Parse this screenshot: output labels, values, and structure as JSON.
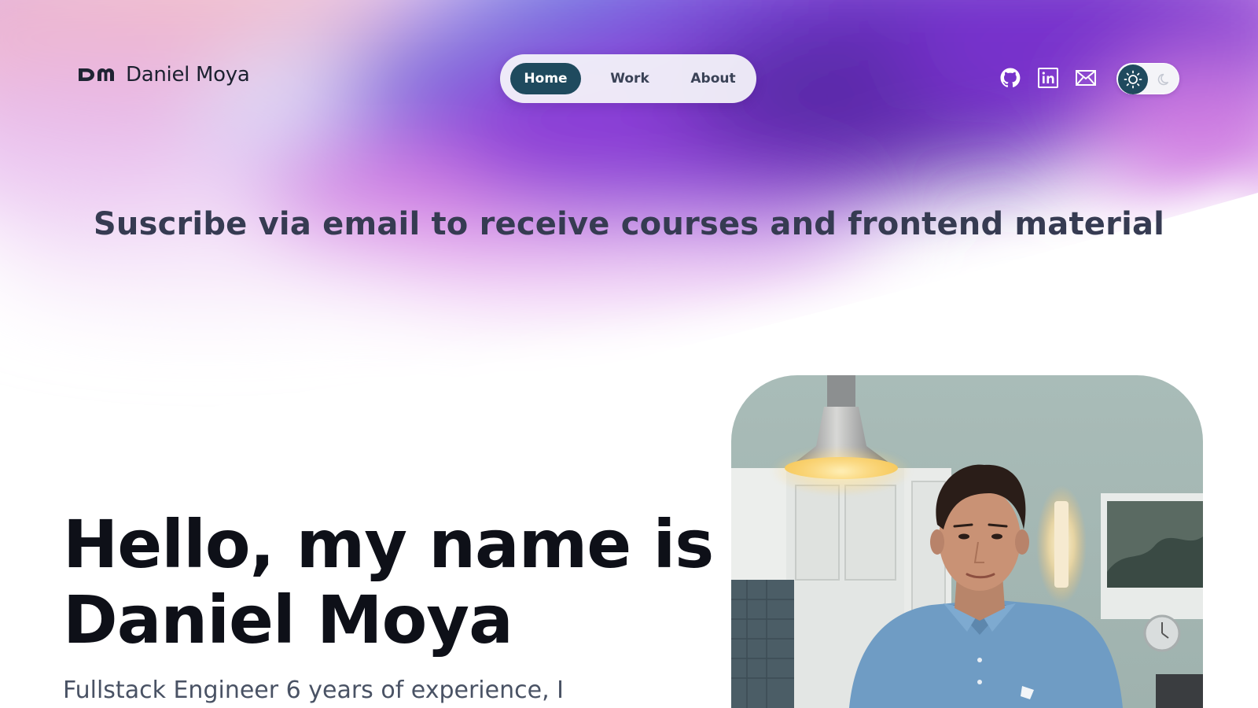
{
  "header": {
    "brand": {
      "logo_text": "DM",
      "name": "Daniel Moya"
    },
    "nav": [
      {
        "label": "Home",
        "active": true
      },
      {
        "label": "Work",
        "active": false
      },
      {
        "label": "About",
        "active": false
      }
    ],
    "social_icons": [
      "github-icon",
      "linkedin-icon",
      "mail-icon"
    ],
    "theme_toggle": {
      "selected": "light",
      "icons": [
        "sun-icon",
        "moon-icon"
      ]
    }
  },
  "banner": {
    "text": "Suscribe via email to receive courses and frontend material"
  },
  "intro": {
    "title_line1": "Hello, my name is",
    "title_line2": "Daniel Moya",
    "subtitle": "Fullstack Engineer 6 years of experience, I"
  },
  "colors": {
    "accent": "#1f4a5e",
    "gradient_purple": "#7d2fd0",
    "gradient_blue": "#5a6ee0",
    "gradient_pink": "#d27ae0",
    "gradient_peach": "#f4c0ae",
    "text_dark": "#0e1018"
  }
}
